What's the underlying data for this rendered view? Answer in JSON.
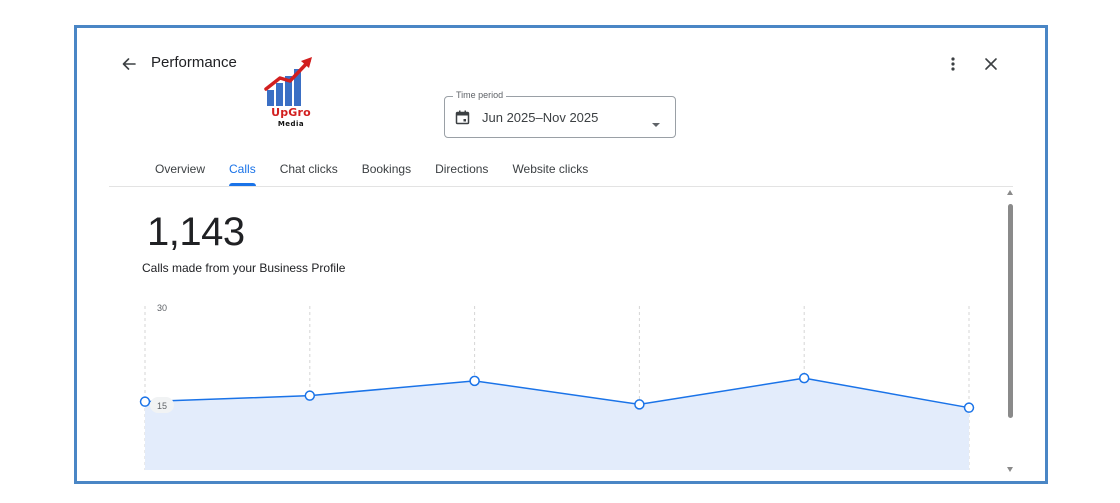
{
  "header": {
    "title": "Performance",
    "back_icon": "arrow-back-icon",
    "more_icon": "more-vert-icon",
    "close_icon": "close-icon"
  },
  "logo": {
    "line1": "UpGro",
    "line2": "Media"
  },
  "time_period": {
    "label": "Time period",
    "value": "Jun 2025–Nov 2025",
    "icon": "calendar-icon"
  },
  "tabs": [
    {
      "label": "Overview",
      "active": false
    },
    {
      "label": "Calls",
      "active": true
    },
    {
      "label": "Chat clicks",
      "active": false
    },
    {
      "label": "Bookings",
      "active": false
    },
    {
      "label": "Directions",
      "active": false
    },
    {
      "label": "Website clicks",
      "active": false
    }
  ],
  "metric": {
    "value": "1,143",
    "caption": "Calls made from your Business Profile"
  },
  "colors": {
    "accent": "#1a73e8",
    "area_fill": "#e3ecfb",
    "frame_border": "#4a86c5"
  },
  "chart_data": {
    "type": "area",
    "x": [
      "",
      "",
      "",
      "",
      "",
      ""
    ],
    "series": [
      {
        "values": [
          12.5,
          13.6,
          16.3,
          12,
          16.8,
          11.4
        ]
      }
    ],
    "ytick_labels": [
      "30",
      "15"
    ],
    "yticks": [
      30,
      15
    ],
    "ylim": [
      0,
      30
    ],
    "grid": "vertical dashed"
  }
}
